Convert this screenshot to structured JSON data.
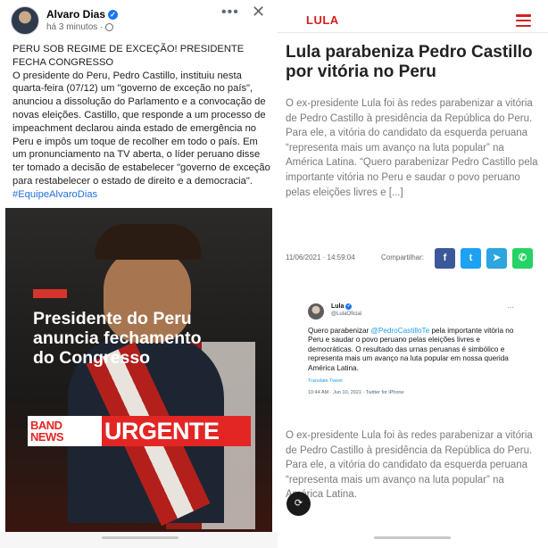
{
  "facebook_post": {
    "author": "Alvaro Dias",
    "time": "há 3 minutos ·",
    "more": "•••",
    "close": "✕",
    "headline": "PERU SOB REGIME DE EXCEÇÃO! PRESIDENTE FECHA CONGRESSO",
    "body": "O presidente do Peru, Pedro Castillo, instituiu nesta quarta-feira (07/12) um \"governo de exceção no país\", anunciou a dissolução do Parlamento e a convocação de novas eleições. Castillo, que responde a um processo de impeachment declarou ainda estado de emergência no Peru e impôs um toque de recolher em todo o país. Em um pronunciamento na TV aberta, o líder peruano disse ter tomado a decisão de estabelecer \"governo de exceção para restabelecer o estado de direito e a democracia\".",
    "hashtag": "#EquipeAlvaroDias",
    "media": {
      "headline": "Presidente do Peru anuncia fechamento do Congresso",
      "badge_band": "BAND",
      "badge_news": "NEWS",
      "badge_urgente": "URGENTE"
    }
  },
  "article": {
    "logo": "LULA",
    "title": "Lula parabeniza Pedro Castillo por vitória no Peru",
    "excerpt": "O ex-presidente Lula foi às redes parabenizar a vitória de Pedro Castillo à presidência da República do Peru. Para ele, a vitória do candidato da esquerda peruana “representa mais um avanço na luta popular” na América Latina. “Quero parabenizar Pedro Castillo pela importante vitória no Peru e saudar o povo peruano pelas eleições livres e [...]",
    "date": "11/06/2021 · 14:59:04",
    "share_label": "Compartilhar:",
    "share_buttons": [
      {
        "icon": "facebook-icon",
        "glyph": "f",
        "color": "#3b5998"
      },
      {
        "icon": "twitter-icon",
        "glyph": "t",
        "color": "#1da1f2"
      },
      {
        "icon": "telegram-icon",
        "glyph": "➤",
        "color": "#2ca5e0"
      },
      {
        "icon": "whatsapp-icon",
        "glyph": "✆",
        "color": "#25d366"
      }
    ],
    "tweet": {
      "name": "Lula",
      "handle": "@LulaOficial",
      "more": "···",
      "text_before": "Quero parabenizar ",
      "mention": "@PedroCastilloTe",
      "text_after": " pela importante vitória no Peru e saudar o povo peruano pelas eleições livres e democráticas. O resultado das urnas peruanas é simbólico e representa mais um avanço na luta popular em nossa querida América Latina.",
      "translate": "Translate Tweet",
      "date": "10:44 AM · Jun 10, 2021 · Twitter for iPhone"
    },
    "excerpt2": "O ex-presidente Lula foi às redes parabenizar a vitória de Pedro Castillo à presidência da República do Peru. Para ele, a vitória do candidato da esquerda peruana “representa mais um avanço na luta popular” na América Latina."
  },
  "colors": {
    "facebook_blue": "#1877f2",
    "lula_red": "#d42020",
    "band_red": "#e32624"
  }
}
